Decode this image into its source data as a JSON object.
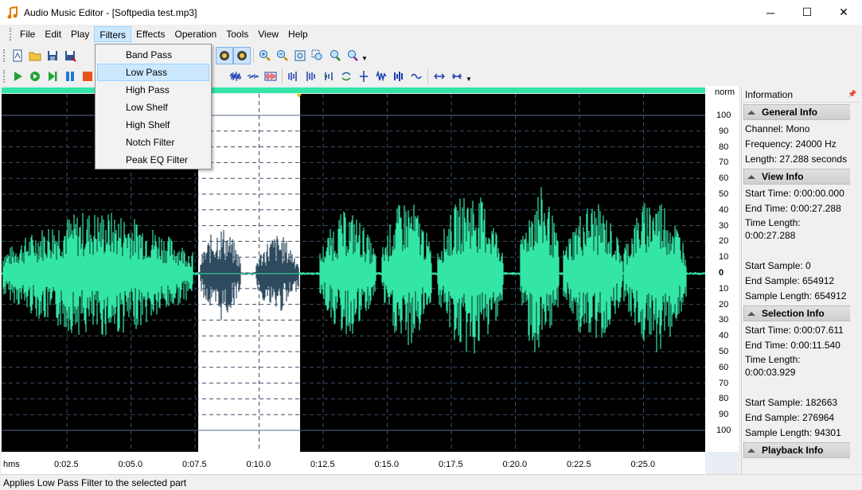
{
  "window": {
    "title": "Audio Music Editor - [Softpedia test.mp3]",
    "minimize": "─",
    "maximize": "☐",
    "close": "✕"
  },
  "menubar": {
    "items": [
      "File",
      "Edit",
      "Play",
      "Filters",
      "Effects",
      "Operation",
      "Tools",
      "View",
      "Help"
    ],
    "active": "Filters"
  },
  "filters_menu": {
    "items": [
      "Band Pass",
      "Low Pass",
      "High Pass",
      "Low Shelf",
      "High Shelf",
      "Notch Filter",
      "Peak EQ Filter"
    ],
    "highlighted": "Low Pass"
  },
  "waveform": {
    "norm_label": "norm",
    "amplitude_ticks": [
      "100",
      "90",
      "80",
      "70",
      "60",
      "50",
      "40",
      "30",
      "20",
      "10",
      "0",
      "10",
      "20",
      "30",
      "40",
      "50",
      "60",
      "70",
      "80",
      "90",
      "100"
    ],
    "time_unit": "hms",
    "time_ticks": [
      "0:02.5",
      "0:05.0",
      "0:07.5",
      "0:10.0",
      "0:12.5",
      "0:15.0",
      "0:17.5",
      "0:20.0",
      "0:22.5",
      "0:25.0"
    ],
    "wave_color": "#33e6a6",
    "selected_wave_color": "#2d4a5e",
    "background_color": "#000000",
    "selection_start_seconds": 7.611,
    "selection_end_seconds": 11.54,
    "total_seconds": 27.288
  },
  "info_panel": {
    "title": "Information",
    "general": {
      "header": "General Info",
      "lines": [
        "Channel: Mono",
        "Frequency: 24000 Hz",
        "Length: 27.288 seconds"
      ]
    },
    "view": {
      "header": "View Info",
      "lines": [
        "Start Time: 0:00:00.000",
        "End Time: 0:00:27.288",
        "Time Length:",
        "0:00:27.288",
        "",
        "Start Sample: 0",
        "End Sample: 654912",
        "Sample Length: 654912"
      ]
    },
    "selection": {
      "header": "Selection Info",
      "lines": [
        "Start Time: 0:00:07.611",
        "End Time: 0:00:11.540",
        "Time Length:",
        "0:00:03.929",
        "",
        "Start Sample: 182663",
        "End Sample: 276964",
        "Sample Length: 94301"
      ]
    },
    "playback": {
      "header": "Playback Info"
    }
  },
  "statusbar": {
    "text": "Applies Low Pass Filter to the selected part"
  }
}
